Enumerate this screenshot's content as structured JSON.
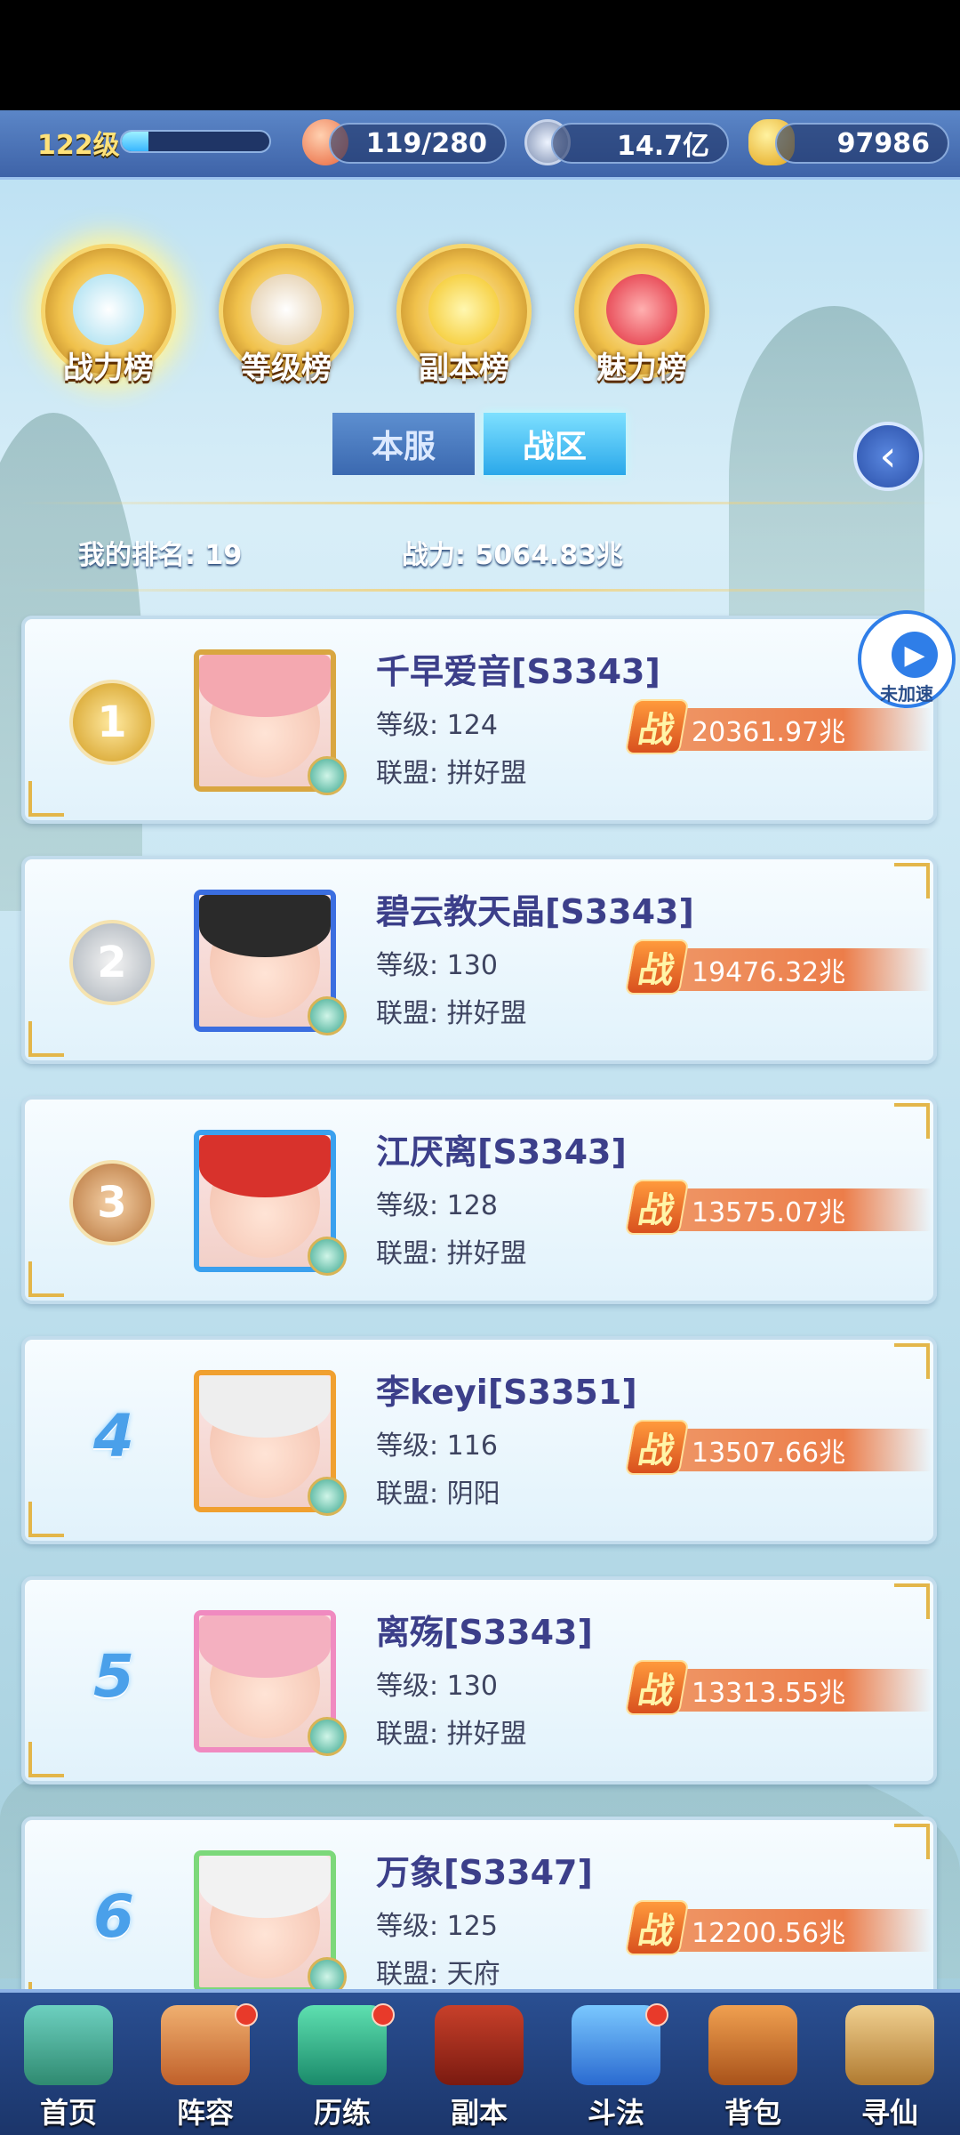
{
  "header": {
    "level": "122级",
    "xp_fraction": 0.18,
    "stamina": "119/280",
    "coins": "14.7亿",
    "gold": "97986"
  },
  "categories": [
    {
      "label": "战力榜",
      "active": true
    },
    {
      "label": "等级榜",
      "active": false
    },
    {
      "label": "副本榜",
      "active": false
    },
    {
      "label": "魅力榜",
      "active": false
    }
  ],
  "tabs": [
    {
      "label": "本服",
      "active": false
    },
    {
      "label": "战区",
      "active": true
    }
  ],
  "my_rank": {
    "text": "我的排名: 19",
    "power": "战力: 5064.83兆"
  },
  "speedup": {
    "label": "未加速"
  },
  "ranking": [
    {
      "rank": "1",
      "name": "千早爱音[S3343]",
      "level": "等级: 124",
      "alliance": "联盟: 拼好盟",
      "power": "20361.97兆"
    },
    {
      "rank": "2",
      "name": "碧云教天晶[S3343]",
      "level": "等级: 130",
      "alliance": "联盟: 拼好盟",
      "power": "19476.32兆"
    },
    {
      "rank": "3",
      "name": "江厌离[S3343]",
      "level": "等级: 128",
      "alliance": "联盟: 拼好盟",
      "power": "13575.07兆"
    },
    {
      "rank": "4",
      "name": "李keyi[S3351]",
      "level": "等级: 116",
      "alliance": "联盟: 阴阳",
      "power": "13507.66兆"
    },
    {
      "rank": "5",
      "name": "离殇[S3343]",
      "level": "等级: 130",
      "alliance": "联盟: 拼好盟",
      "power": "13313.55兆"
    },
    {
      "rank": "6",
      "name": "万象[S3347]",
      "level": "等级: 125",
      "alliance": "联盟: 天府",
      "power": "12200.56兆"
    }
  ],
  "power_glyph": "战",
  "nav": [
    {
      "label": "首页",
      "dot": false
    },
    {
      "label": "阵容",
      "dot": true
    },
    {
      "label": "历练",
      "dot": true
    },
    {
      "label": "副本",
      "dot": false
    },
    {
      "label": "斗法",
      "dot": true
    },
    {
      "label": "背包",
      "dot": false
    },
    {
      "label": "寻仙",
      "dot": false
    }
  ]
}
